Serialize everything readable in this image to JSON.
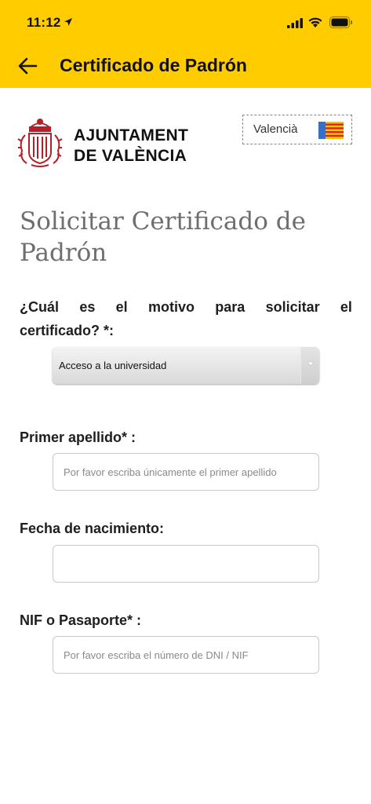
{
  "status_bar": {
    "time": "11:12"
  },
  "app_bar": {
    "title": "Certificado de Padrón"
  },
  "brand": {
    "line1": "AJUNTAMENT",
    "line2": "DE VALÈNCIA"
  },
  "language": {
    "label": "Valencià"
  },
  "form": {
    "heading": "Solicitar Certificado de Padrón",
    "motivo": {
      "label_words": [
        "¿Cuál",
        "es",
        "el",
        "motivo",
        "para",
        "solicitar",
        "el"
      ],
      "label_line2": "certificado? *:",
      "selected": "Acceso a la universidad"
    },
    "apellido": {
      "label": "Primer apellido* :",
      "placeholder": "Por favor escriba únicamente el primer apellido"
    },
    "fecha": {
      "label": "Fecha de nacimiento:",
      "placeholder": ""
    },
    "nif": {
      "label": "NIF o Pasaporte* :",
      "placeholder": "Por favor escriba el número de DNI / NIF"
    }
  },
  "colors": {
    "app_bar": "#ffcc00",
    "heading": "#6e6e6e",
    "brand_red": "#b3202a"
  }
}
